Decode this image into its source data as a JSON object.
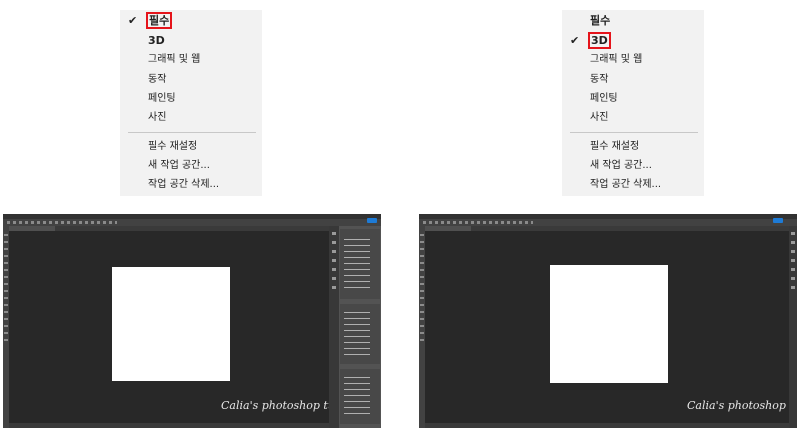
{
  "workspace_menu_left": {
    "items": [
      "필수",
      "3D",
      "그래픽 및 웹",
      "동작",
      "페인팅",
      "사진"
    ],
    "actions": [
      "필수 재설정",
      "새 작업 공간...",
      "작업 공간 삭제..."
    ],
    "checked": "필수"
  },
  "workspace_menu_right": {
    "items": [
      "필수",
      "3D",
      "그래픽 및 웹",
      "동작",
      "페인팅",
      "사진"
    ],
    "actions": [
      "필수 재설정",
      "새 작업 공간...",
      "작업 공간 삭제..."
    ],
    "checked": "3D"
  },
  "highlight_color": "#e5141b",
  "screenshots": {
    "left": {
      "workspace": "필수",
      "watermark": "Calia's photoshop tutorial"
    },
    "right": {
      "workspace": "3D",
      "watermark": "Calia's photoshop tutorial"
    }
  }
}
